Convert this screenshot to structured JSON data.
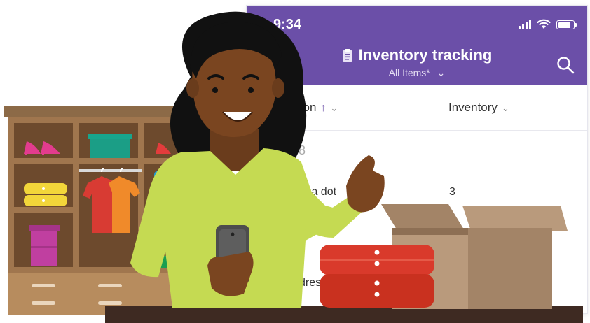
{
  "status_bar": {
    "time": "9:34"
  },
  "header": {
    "title": "Inventory tracking",
    "view": "All Items*",
    "view_chevron": "⌄"
  },
  "columns": [
    {
      "label": "tion",
      "sort_arrow": "↑",
      "chevron": "⌄"
    },
    {
      "label": "Inventory",
      "chevron": "⌄"
    }
  ],
  "rows": [
    {
      "title": "4778",
      "inventory": ""
    },
    {
      "title": "olka dot",
      "inventory": "3"
    },
    {
      "title": "dress",
      "inventory": ""
    }
  ],
  "colors": {
    "header_purple": "#6b4fa8",
    "shirt_green": "#c5da52",
    "skin": "#7a4520",
    "red_items": "#d93a2b",
    "box_brown": "#b99a7c",
    "shelf_brown": "#a0764e"
  },
  "icons": [
    "clipboard-icon",
    "search-icon",
    "signal-icon",
    "wifi-icon",
    "battery-icon",
    "chevron-down-icon",
    "sort-up-icon"
  ]
}
